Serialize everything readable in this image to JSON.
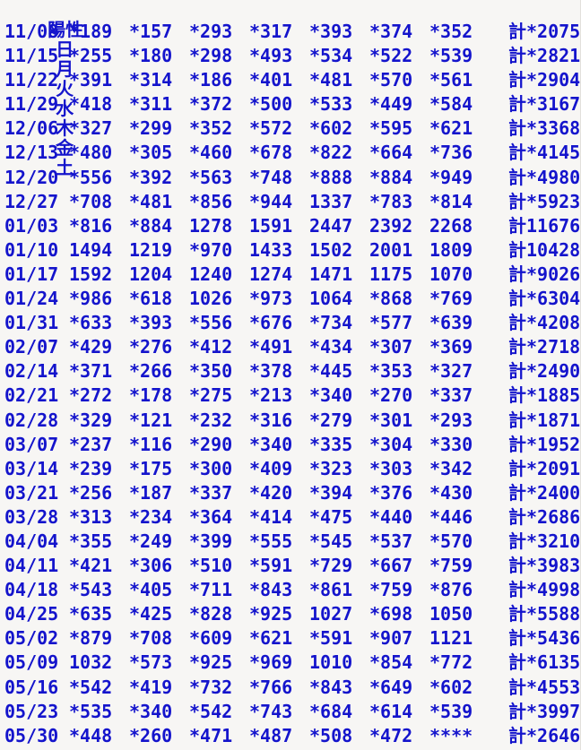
{
  "meta": {
    "text_color": "#1414cc",
    "background_color": "#f7f6f4",
    "pad_char": "*",
    "total_prefix": "計"
  },
  "header": {
    "row_label": "陽性",
    "days": [
      "日",
      "月",
      "火",
      "水",
      "木",
      "金",
      "土"
    ],
    "total_label": ""
  },
  "chart_data": {
    "type": "table",
    "title": "陽性",
    "columns": [
      "陽性",
      "日",
      "月",
      "火",
      "水",
      "木",
      "金",
      "土",
      "計"
    ],
    "rows": [
      {
        "date": "11/08",
        "values": [
          "*189",
          "*157",
          "*293",
          "*317",
          "*393",
          "*374",
          "*352"
        ],
        "total": "計*2075"
      },
      {
        "date": "11/15",
        "values": [
          "*255",
          "*180",
          "*298",
          "*493",
          "*534",
          "*522",
          "*539"
        ],
        "total": "計*2821"
      },
      {
        "date": "11/22",
        "values": [
          "*391",
          "*314",
          "*186",
          "*401",
          "*481",
          "*570",
          "*561"
        ],
        "total": "計*2904"
      },
      {
        "date": "11/29",
        "values": [
          "*418",
          "*311",
          "*372",
          "*500",
          "*533",
          "*449",
          "*584"
        ],
        "total": "計*3167"
      },
      {
        "date": "12/06",
        "values": [
          "*327",
          "*299",
          "*352",
          "*572",
          "*602",
          "*595",
          "*621"
        ],
        "total": "計*3368"
      },
      {
        "date": "12/13",
        "values": [
          "*480",
          "*305",
          "*460",
          "*678",
          "*822",
          "*664",
          "*736"
        ],
        "total": "計*4145"
      },
      {
        "date": "12/20",
        "values": [
          "*556",
          "*392",
          "*563",
          "*748",
          "*888",
          "*884",
          "*949"
        ],
        "total": "計*4980"
      },
      {
        "date": "12/27",
        "values": [
          "*708",
          "*481",
          "*856",
          "*944",
          "1337",
          "*783",
          "*814"
        ],
        "total": "計*5923"
      },
      {
        "date": "01/03",
        "values": [
          "*816",
          "*884",
          "1278",
          "1591",
          "2447",
          "2392",
          "2268"
        ],
        "total": "計11676"
      },
      {
        "date": "01/10",
        "values": [
          "1494",
          "1219",
          "*970",
          "1433",
          "1502",
          "2001",
          "1809"
        ],
        "total": "計10428"
      },
      {
        "date": "01/17",
        "values": [
          "1592",
          "1204",
          "1240",
          "1274",
          "1471",
          "1175",
          "1070"
        ],
        "total": "計*9026"
      },
      {
        "date": "01/24",
        "values": [
          "*986",
          "*618",
          "1026",
          "*973",
          "1064",
          "*868",
          "*769"
        ],
        "total": "計*6304"
      },
      {
        "date": "01/31",
        "values": [
          "*633",
          "*393",
          "*556",
          "*676",
          "*734",
          "*577",
          "*639"
        ],
        "total": "計*4208"
      },
      {
        "date": "02/07",
        "values": [
          "*429",
          "*276",
          "*412",
          "*491",
          "*434",
          "*307",
          "*369"
        ],
        "total": "計*2718"
      },
      {
        "date": "02/14",
        "values": [
          "*371",
          "*266",
          "*350",
          "*378",
          "*445",
          "*353",
          "*327"
        ],
        "total": "計*2490"
      },
      {
        "date": "02/21",
        "values": [
          "*272",
          "*178",
          "*275",
          "*213",
          "*340",
          "*270",
          "*337"
        ],
        "total": "計*1885"
      },
      {
        "date": "02/28",
        "values": [
          "*329",
          "*121",
          "*232",
          "*316",
          "*279",
          "*301",
          "*293"
        ],
        "total": "計*1871"
      },
      {
        "date": "03/07",
        "values": [
          "*237",
          "*116",
          "*290",
          "*340",
          "*335",
          "*304",
          "*330"
        ],
        "total": "計*1952"
      },
      {
        "date": "03/14",
        "values": [
          "*239",
          "*175",
          "*300",
          "*409",
          "*323",
          "*303",
          "*342"
        ],
        "total": "計*2091"
      },
      {
        "date": "03/21",
        "values": [
          "*256",
          "*187",
          "*337",
          "*420",
          "*394",
          "*376",
          "*430"
        ],
        "total": "計*2400"
      },
      {
        "date": "03/28",
        "values": [
          "*313",
          "*234",
          "*364",
          "*414",
          "*475",
          "*440",
          "*446"
        ],
        "total": "計*2686"
      },
      {
        "date": "04/04",
        "values": [
          "*355",
          "*249",
          "*399",
          "*555",
          "*545",
          "*537",
          "*570"
        ],
        "total": "計*3210"
      },
      {
        "date": "04/11",
        "values": [
          "*421",
          "*306",
          "*510",
          "*591",
          "*729",
          "*667",
          "*759"
        ],
        "total": "計*3983"
      },
      {
        "date": "04/18",
        "values": [
          "*543",
          "*405",
          "*711",
          "*843",
          "*861",
          "*759",
          "*876"
        ],
        "total": "計*4998"
      },
      {
        "date": "04/25",
        "values": [
          "*635",
          "*425",
          "*828",
          "*925",
          "1027",
          "*698",
          "1050"
        ],
        "total": "計*5588"
      },
      {
        "date": "05/02",
        "values": [
          "*879",
          "*708",
          "*609",
          "*621",
          "*591",
          "*907",
          "1121"
        ],
        "total": "計*5436"
      },
      {
        "date": "05/09",
        "values": [
          "1032",
          "*573",
          "*925",
          "*969",
          "1010",
          "*854",
          "*772"
        ],
        "total": "計*6135"
      },
      {
        "date": "05/16",
        "values": [
          "*542",
          "*419",
          "*732",
          "*766",
          "*843",
          "*649",
          "*602"
        ],
        "total": "計*4553"
      },
      {
        "date": "05/23",
        "values": [
          "*535",
          "*340",
          "*542",
          "*743",
          "*684",
          "*614",
          "*539"
        ],
        "total": "計*3997"
      },
      {
        "date": "05/30",
        "values": [
          "*448",
          "*260",
          "*471",
          "*487",
          "*508",
          "*472",
          "****"
        ],
        "total": "計*2646"
      }
    ]
  }
}
